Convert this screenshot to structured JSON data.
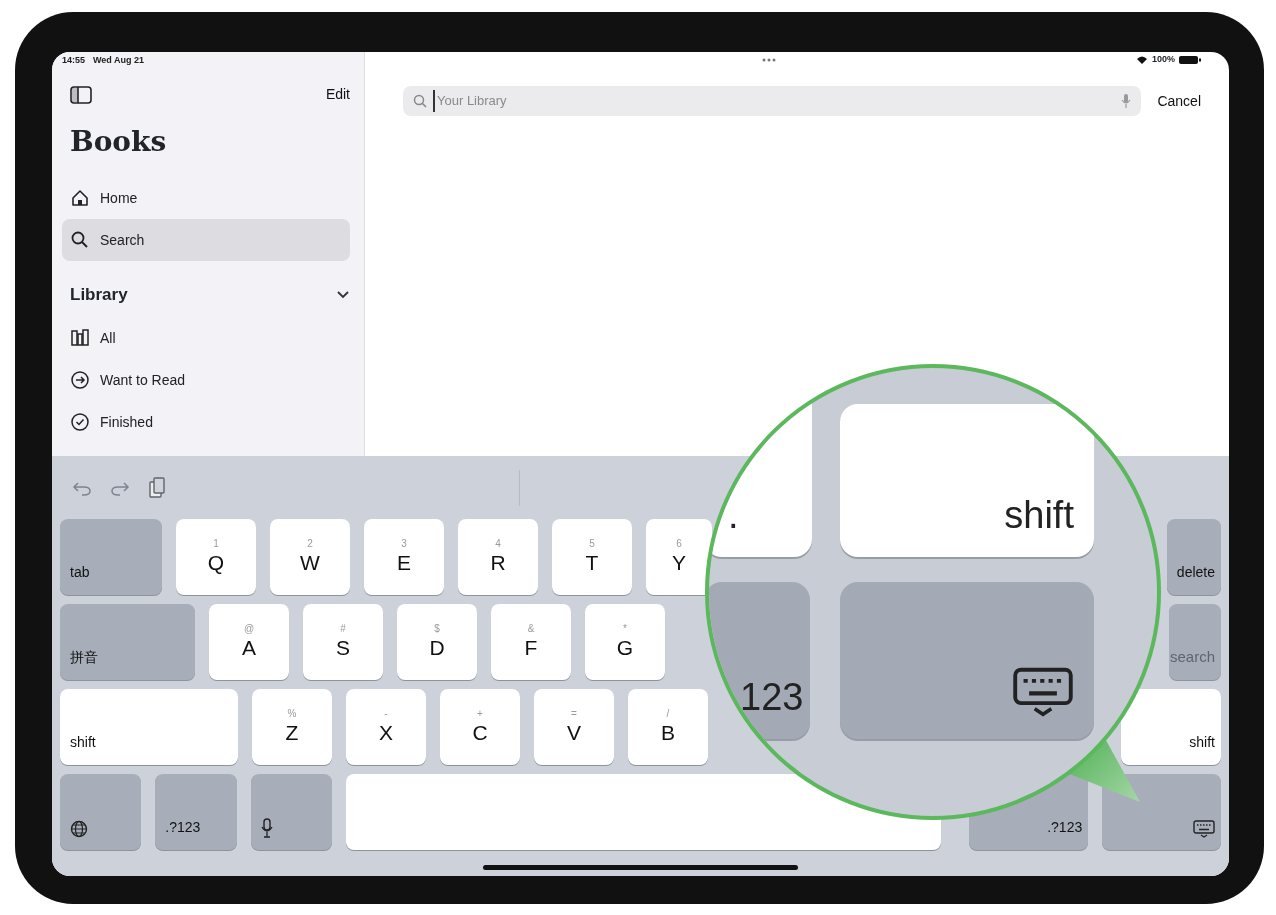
{
  "status_bar": {
    "time": "14:55",
    "date": "Wed Aug 21",
    "battery": "100%"
  },
  "sidebar": {
    "edit": "Edit",
    "title": "Books",
    "items": [
      {
        "label": "Home",
        "selected": false
      },
      {
        "label": "Search",
        "selected": true
      }
    ],
    "section": {
      "title": "Library",
      "expanded": true,
      "items": [
        {
          "label": "All"
        },
        {
          "label": "Want to Read"
        },
        {
          "label": "Finished"
        }
      ]
    }
  },
  "search": {
    "placeholder": "Your Library",
    "cancel": "Cancel"
  },
  "keyboard": {
    "rows": [
      {
        "left": [
          {
            "kind": "modifier",
            "label": "tab"
          },
          {
            "kind": "letter",
            "label": "Q",
            "hint": "1"
          },
          {
            "kind": "letter",
            "label": "W",
            "hint": "2"
          },
          {
            "kind": "letter",
            "label": "E",
            "hint": "3"
          },
          {
            "kind": "letter",
            "label": "R",
            "hint": "4"
          },
          {
            "kind": "letter",
            "label": "T",
            "hint": "5"
          },
          {
            "kind": "letter",
            "label": "Y",
            "hint": "6"
          }
        ],
        "right": [
          {
            "kind": "modifier",
            "label": "delete"
          }
        ]
      },
      {
        "left": [
          {
            "kind": "modifier",
            "label": "拼音"
          },
          {
            "kind": "letter",
            "label": "A",
            "hint": "@"
          },
          {
            "kind": "letter",
            "label": "S",
            "hint": "#"
          },
          {
            "kind": "letter",
            "label": "D",
            "hint": "$"
          },
          {
            "kind": "letter",
            "label": "F",
            "hint": "&"
          },
          {
            "kind": "letter",
            "label": "G",
            "hint": "*"
          }
        ],
        "right": [
          {
            "kind": "action",
            "label": "search"
          }
        ]
      },
      {
        "left": [
          {
            "kind": "wide",
            "label": "shift"
          },
          {
            "kind": "letter",
            "label": "Z",
            "hint": "%"
          },
          {
            "kind": "letter",
            "label": "X",
            "hint": "-"
          },
          {
            "kind": "letter",
            "label": "C",
            "hint": "+"
          },
          {
            "kind": "letter",
            "label": "V",
            "hint": "="
          },
          {
            "kind": "letter",
            "label": "B",
            "hint": "/"
          }
        ],
        "right": [
          {
            "kind": "wide",
            "label": "shift"
          }
        ]
      },
      {
        "left": [
          {
            "kind": "globe"
          },
          {
            "kind": "modifier",
            "label": ".?123"
          },
          {
            "kind": "mic"
          },
          {
            "kind": "space"
          }
        ],
        "right": [
          {
            "kind": "modifier",
            "label": ".?123"
          },
          {
            "kind": "hide"
          }
        ]
      }
    ]
  },
  "magnifier": {
    "keys": [
      {
        "kind": "wide",
        "label": "."
      },
      {
        "kind": "wide",
        "label": "shift"
      },
      {
        "kind": "modifier",
        "label": "123"
      },
      {
        "kind": "hide"
      }
    ]
  }
}
